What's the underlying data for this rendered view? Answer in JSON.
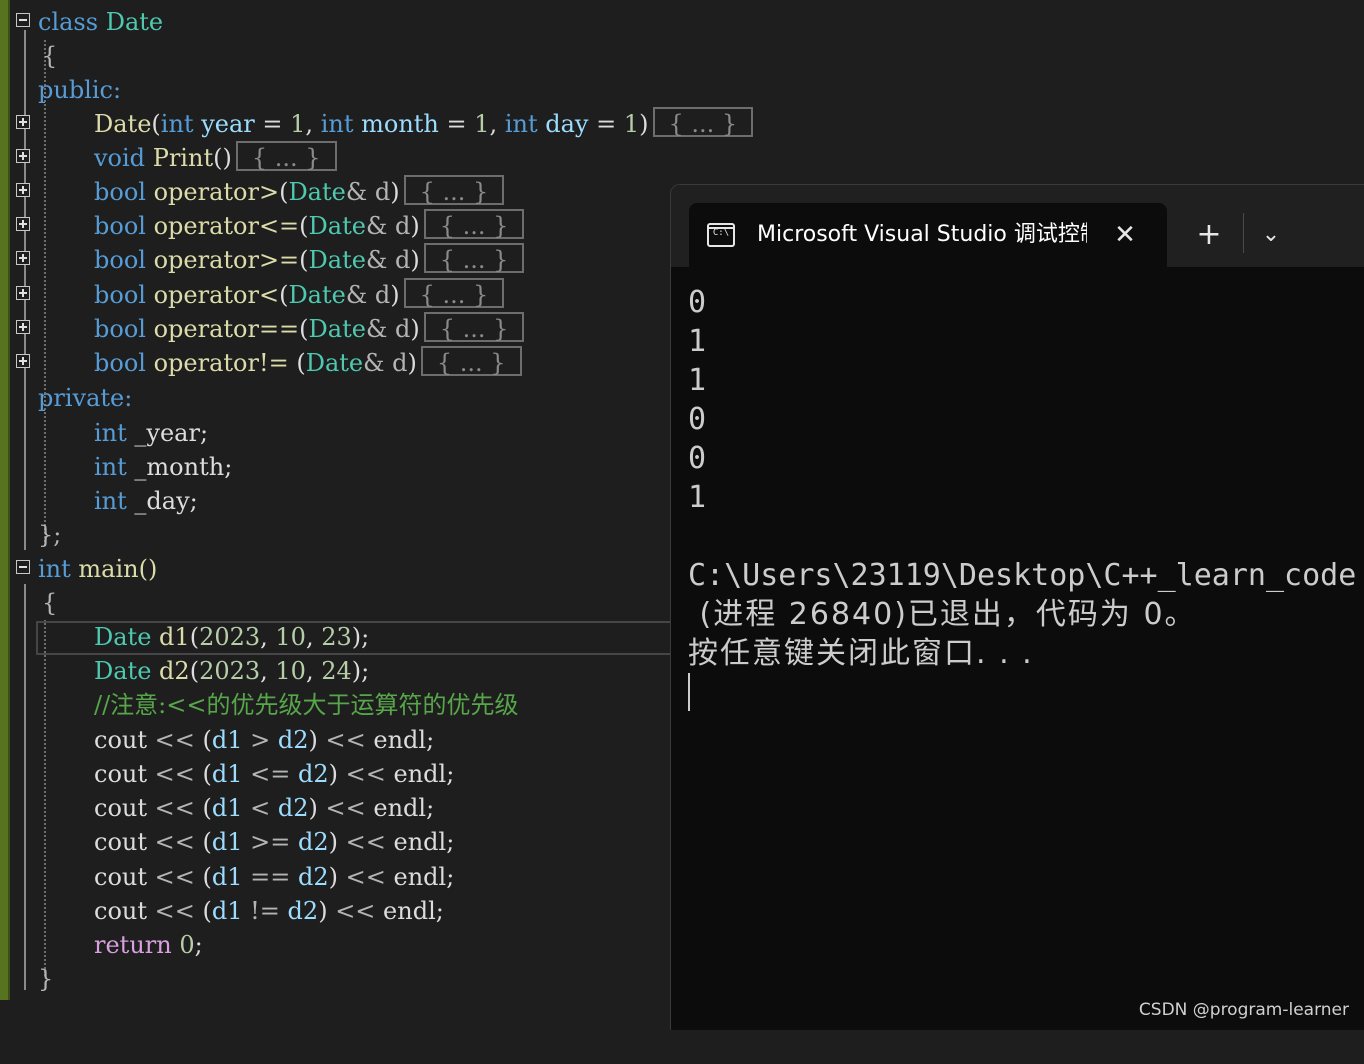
{
  "editor": {
    "class_keyword": "class",
    "class_name": "Date",
    "open_brace": "{",
    "public_label": "public:",
    "ctor": {
      "name": "Date",
      "int": "int",
      "year": "year",
      "month": "month",
      "day": "day",
      "eq": "=",
      "one": "1",
      "collapsed": "{ ... }"
    },
    "print": {
      "type": "void",
      "name": "Print",
      "parens": "()",
      "collapsed": "{ ... }"
    },
    "operators": [
      {
        "op": "operator>",
        "gap": ""
      },
      {
        "op": "operator<=",
        "gap": ""
      },
      {
        "op": "operator>=",
        "gap": ""
      },
      {
        "op": "operator<",
        "gap": ""
      },
      {
        "op": "operator==",
        "gap": ""
      },
      {
        "op": "operator!=",
        "gap": " "
      }
    ],
    "bool": "bool",
    "param_type": "Date",
    "param_rest": "& d",
    "collapsed": "{ ... }",
    "private_label": "private:",
    "members": [
      "_year;",
      "_month;",
      "_day;"
    ],
    "int": "int",
    "class_close": "};",
    "main_sig": "main()",
    "main_close": "}",
    "d1_decl": {
      "type": "Date",
      "name": "d1",
      "args": [
        "2023",
        "10",
        "23"
      ]
    },
    "d2_decl": {
      "type": "Date",
      "name": "d2",
      "args": [
        "2023",
        "10",
        "24"
      ]
    },
    "comment": "//注意:<<的优先级大于运算符的优先级",
    "couts": [
      ">",
      "<=",
      "<",
      ">=",
      "==",
      "!="
    ],
    "cout": "cout",
    "endl": "endl",
    "return_kw": "return",
    "return_val": "0"
  },
  "console": {
    "tab_title": "Microsoft Visual Studio 调试控制台",
    "icon_label": "C:\\",
    "close_glyph": "✕",
    "new_tab_glyph": "+",
    "dropdown_glyph": "⌄",
    "output_values": [
      "0",
      "1",
      "1",
      "0",
      "0",
      "1"
    ],
    "exit_path": "C:\\Users\\23119\\Desktop\\C++_learn_code",
    "exit_msg": " (进程 26840)已退出，代码为 0。",
    "close_prompt": "按任意键关闭此窗口. . ."
  },
  "watermark": "CSDN @program-learner",
  "colors": {
    "keyword": "#569cd6",
    "type": "#4ec9b0",
    "function": "#dcdcaa",
    "parameter": "#9cdcfe",
    "number": "#b5cea8",
    "comment": "#57a64a",
    "control": "#d8a0df",
    "gutter": "#57731f"
  }
}
